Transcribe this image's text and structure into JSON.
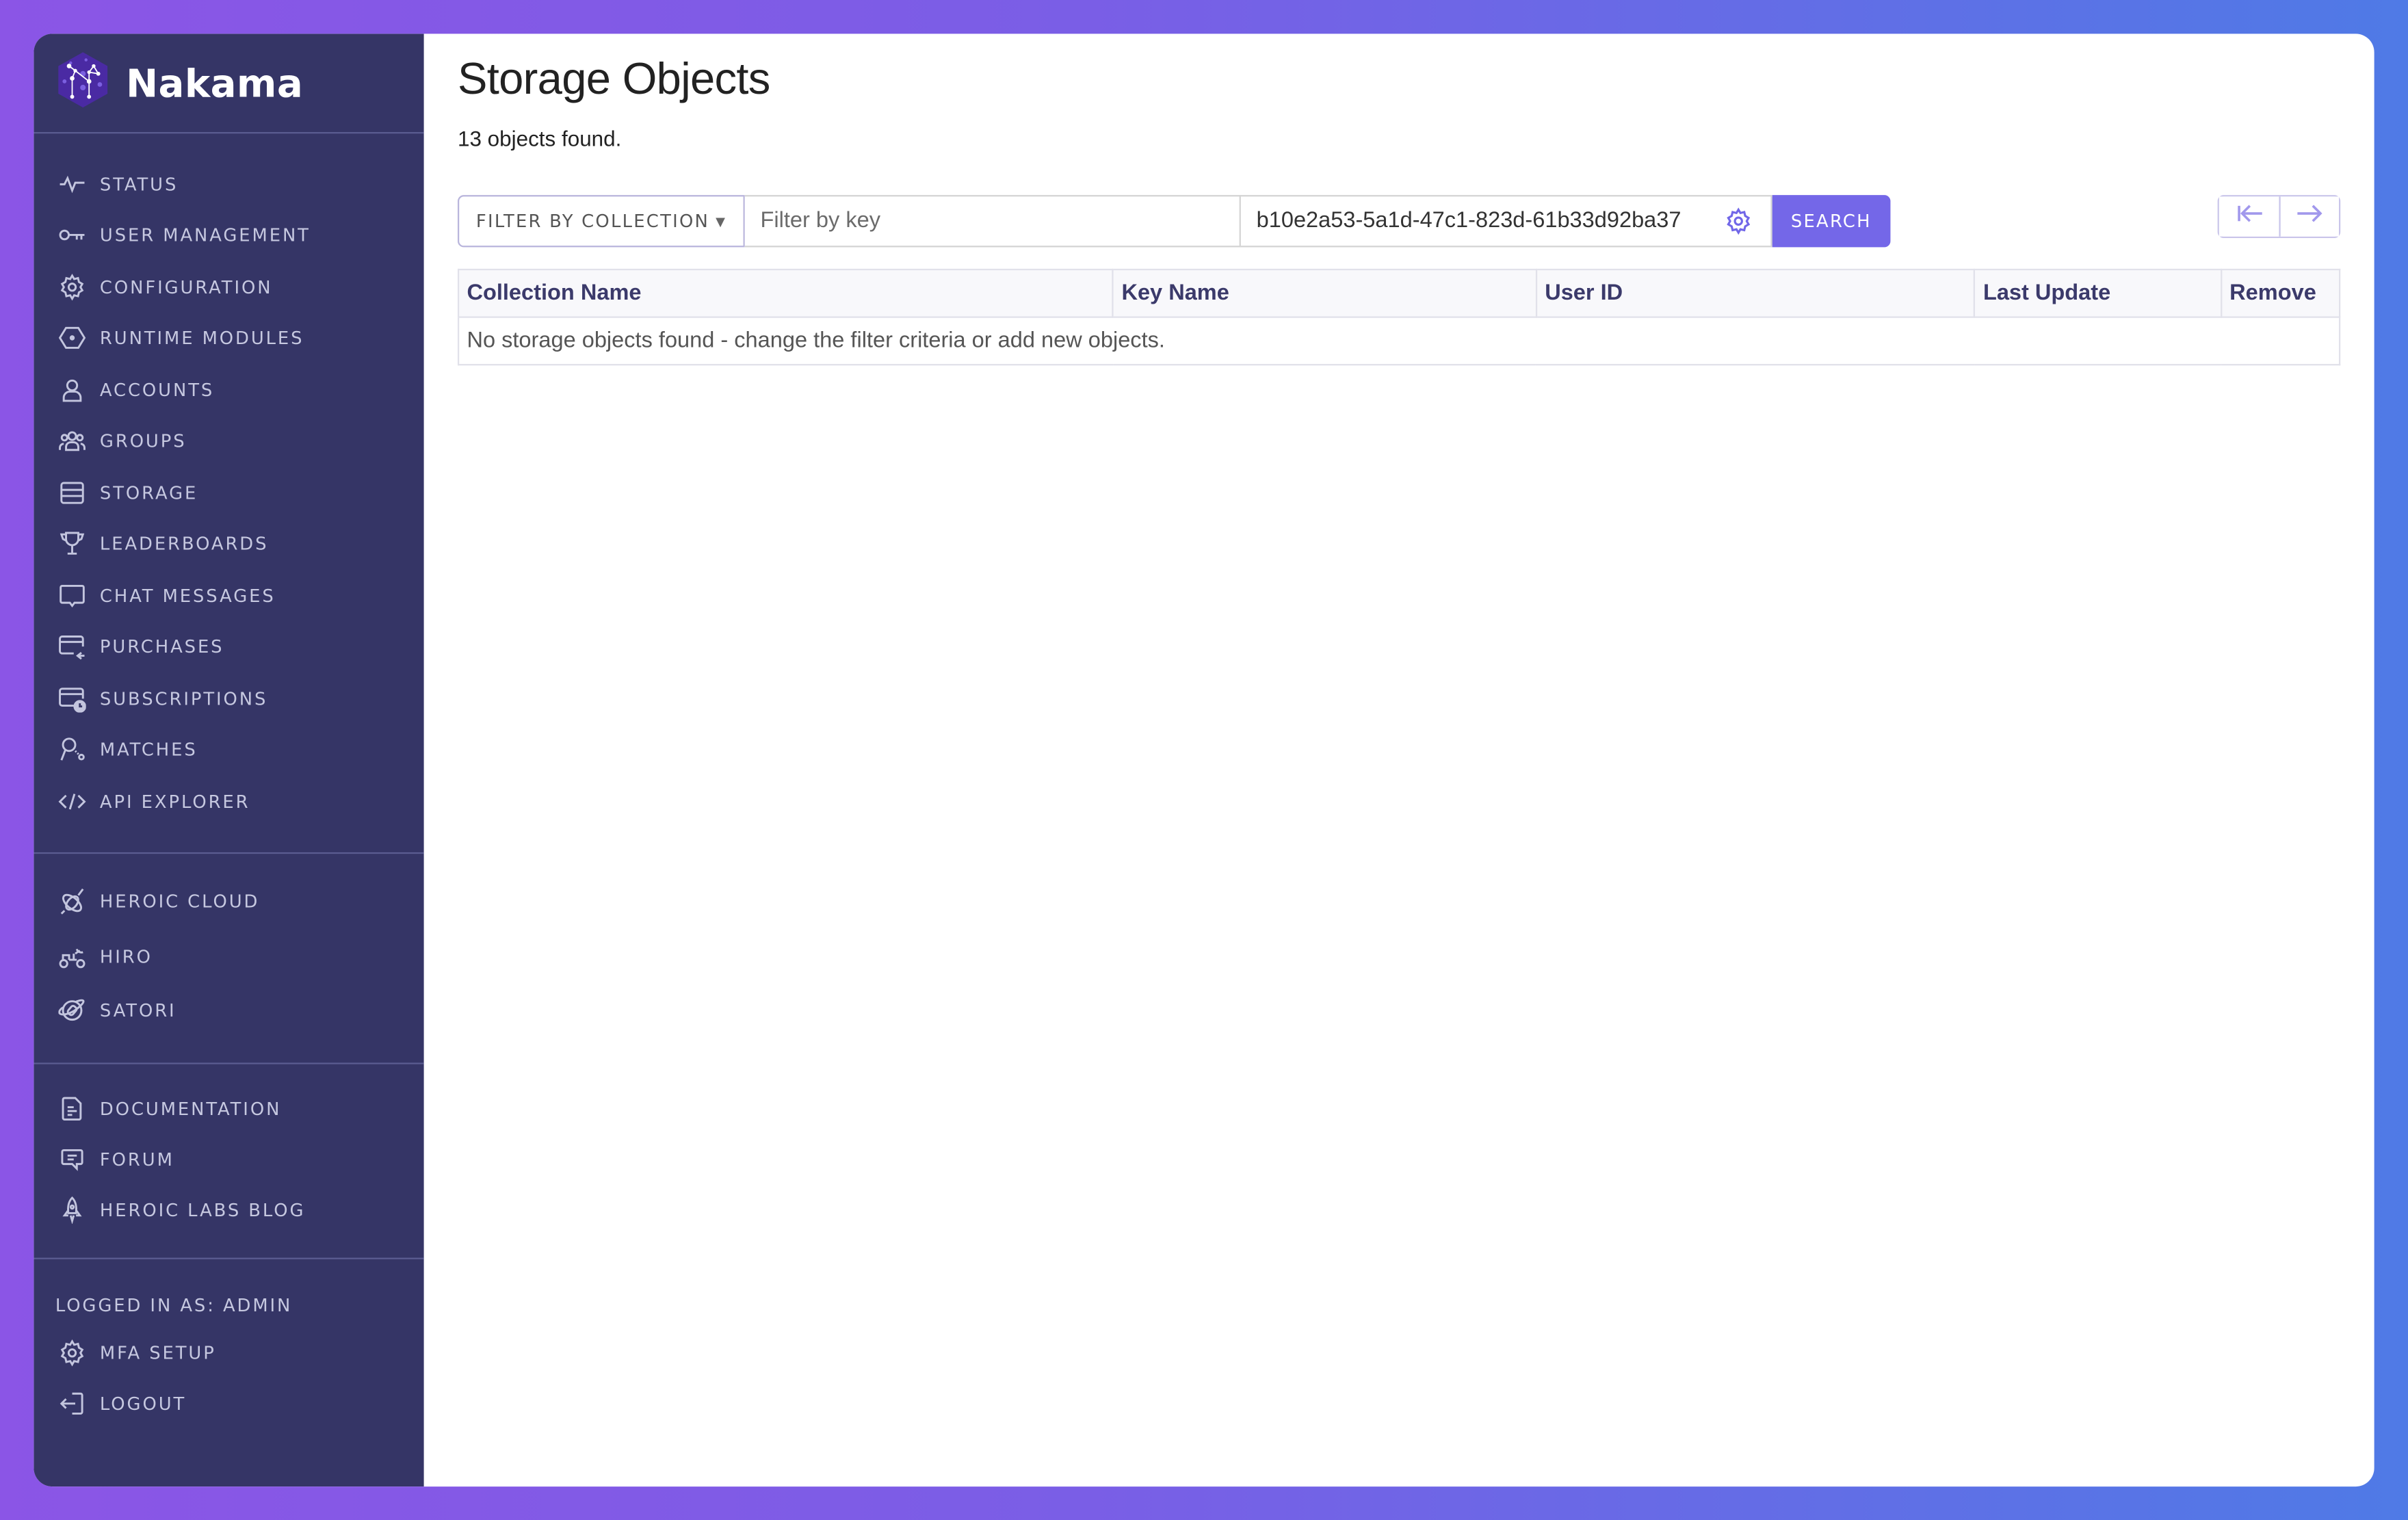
{
  "brand": {
    "name": "Nakama",
    "logo_icon": "constellation-hexagon-icon"
  },
  "sidebar": {
    "main_items": [
      {
        "label": "STATUS",
        "icon": "pulse-icon"
      },
      {
        "label": "USER MANAGEMENT",
        "icon": "key-icon"
      },
      {
        "label": "CONFIGURATION",
        "icon": "gear-icon"
      },
      {
        "label": "RUNTIME MODULES",
        "icon": "hexagon-icon"
      },
      {
        "label": "ACCOUNTS",
        "icon": "user-icon"
      },
      {
        "label": "GROUPS",
        "icon": "users-icon"
      },
      {
        "label": "STORAGE",
        "icon": "storage-icon"
      },
      {
        "label": "LEADERBOARDS",
        "icon": "trophy-icon"
      },
      {
        "label": "CHAT MESSAGES",
        "icon": "chat-icon"
      },
      {
        "label": "PURCHASES",
        "icon": "card-return-icon"
      },
      {
        "label": "SUBSCRIPTIONS",
        "icon": "card-clock-icon"
      },
      {
        "label": "MATCHES",
        "icon": "matches-icon"
      },
      {
        "label": "API EXPLORER",
        "icon": "code-icon"
      }
    ],
    "product_items": [
      {
        "label": "HEROIC CLOUD",
        "icon": "satellite-icon"
      },
      {
        "label": "HIRO",
        "icon": "rover-icon"
      },
      {
        "label": "SATORI",
        "icon": "planet-rocket-icon"
      }
    ],
    "resource_items": [
      {
        "label": "DOCUMENTATION",
        "icon": "document-icon"
      },
      {
        "label": "FORUM",
        "icon": "forum-icon"
      },
      {
        "label": "HEROIC LABS BLOG",
        "icon": "rocket-icon"
      }
    ],
    "logged_in_as": "LOGGED IN AS: ADMIN",
    "account_items": [
      {
        "label": "MFA SETUP",
        "icon": "gear-icon"
      },
      {
        "label": "LOGOUT",
        "icon": "logout-icon"
      }
    ]
  },
  "main": {
    "title": "Storage Objects",
    "count_text": "13 objects found.",
    "filter": {
      "collection_label": "FILTER BY COLLECTION",
      "key_placeholder": "Filter by key",
      "key_value": "",
      "user_id_value": "b10e2a53-5a1d-47c1-823d-61b33d92ba37",
      "search_label": "SEARCH"
    },
    "pager": {
      "first_icon": "first-page-icon",
      "next_icon": "arrow-right-icon"
    },
    "table": {
      "columns": [
        "Collection Name",
        "Key Name",
        "User ID",
        "Last Update",
        "Remove"
      ],
      "empty_message": "No storage objects found - change the filter criteria or add new objects."
    }
  },
  "colors": {
    "sidebar_bg": "#353566",
    "accent": "#7467e8",
    "header_text": "#3b3a6b"
  }
}
